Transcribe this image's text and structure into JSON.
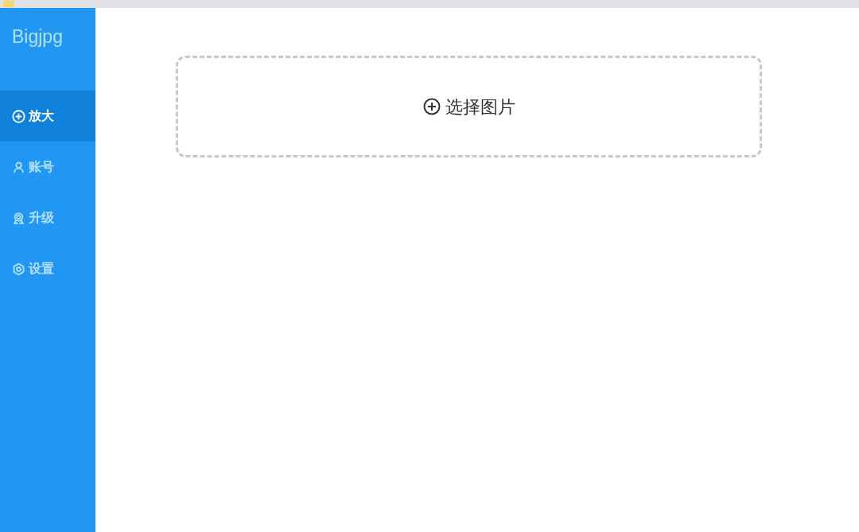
{
  "sidebar": {
    "logo": "Bigjpg",
    "items": [
      {
        "label": "放大",
        "selected": true
      },
      {
        "label": "账号",
        "selected": false
      },
      {
        "label": "升级",
        "selected": false
      },
      {
        "label": "设置",
        "selected": false
      }
    ]
  },
  "upload": {
    "label": "选择图片"
  }
}
